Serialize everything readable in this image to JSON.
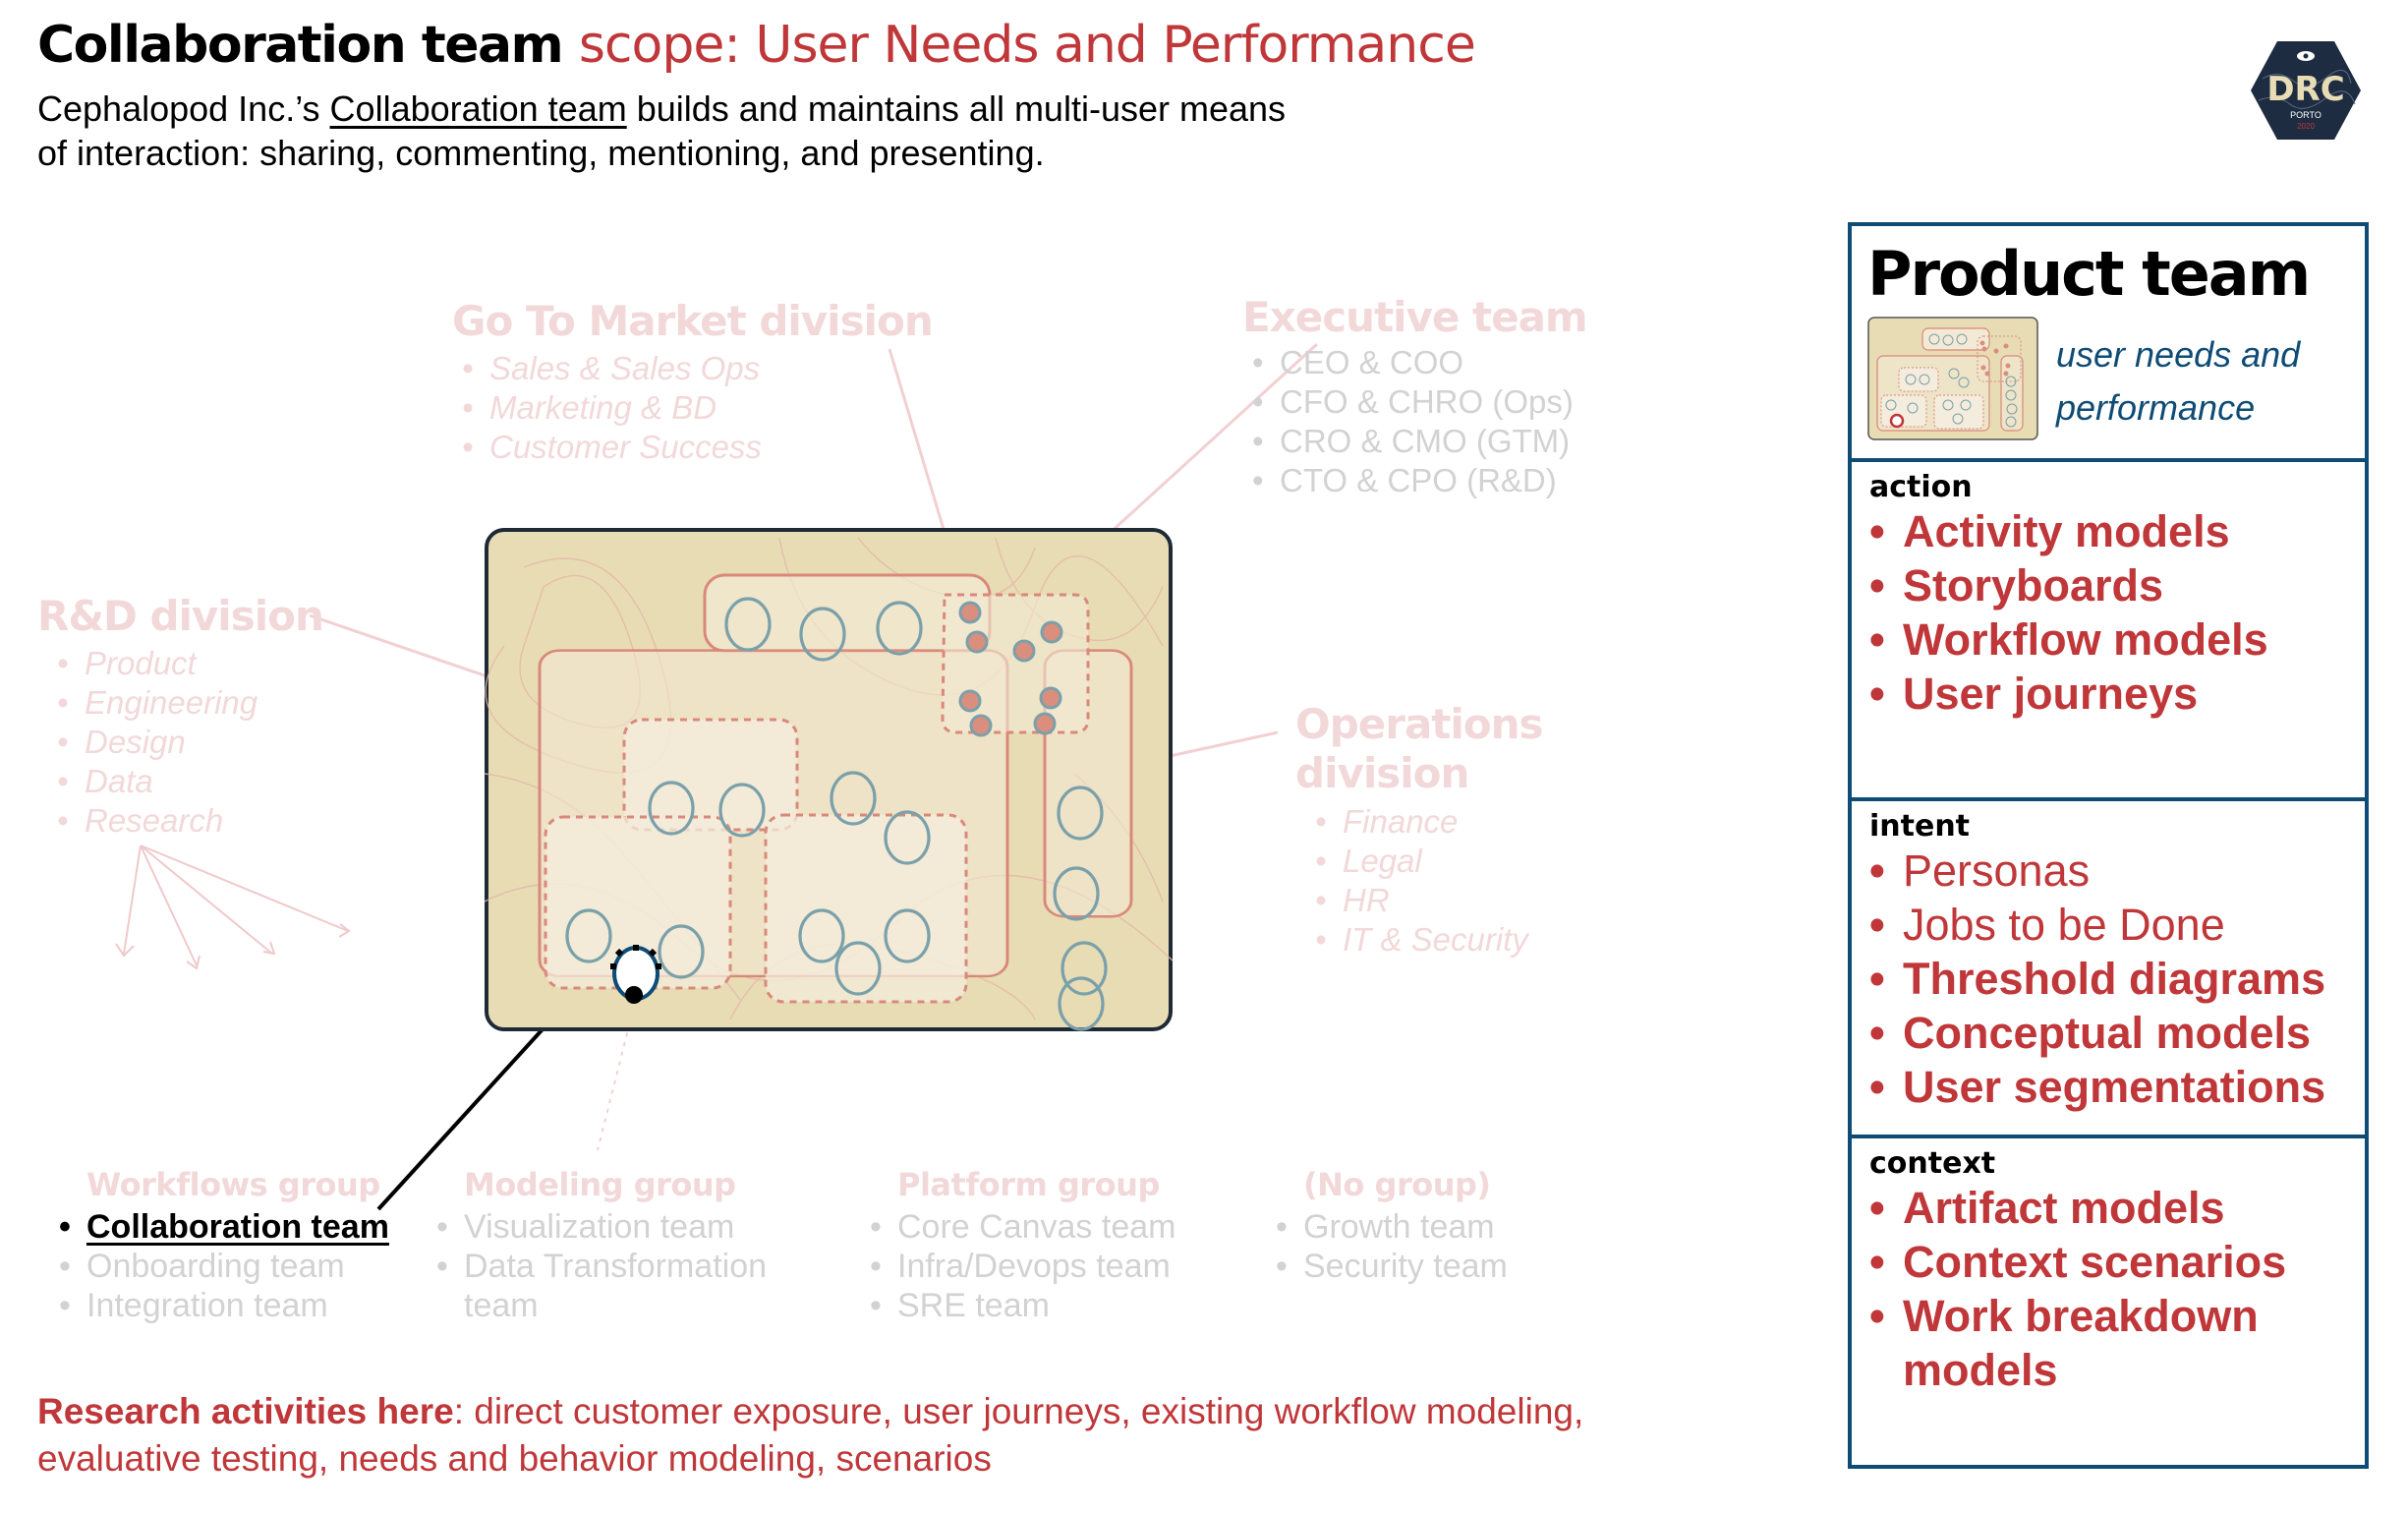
{
  "header": {
    "title_main": "Collaboration team",
    "title_accent": "scope: User Needs and Performance",
    "subtitle_before": "Cephalopod Inc.’s ",
    "subtitle_link": "Collaboration team",
    "subtitle_after": " builds and maintains all multi-user means of interaction: sharing, commenting, mentioning, and presenting."
  },
  "logo": {
    "text": "DRC",
    "city": "PORTO",
    "year": "2020",
    "icon": "eye-icon"
  },
  "colors": {
    "accent_red": "#c0373a",
    "panel_border": "#0f4c75",
    "faint_pink": "#f2d8d9",
    "map_bg": "#e8dcb5",
    "map_border": "#1f2a36",
    "node_ring": "#7aa0aa"
  },
  "divisions": {
    "gtm": {
      "title": "Go To Market division",
      "items": [
        "Sales & Sales Ops",
        "Marketing & BD",
        "Customer Success"
      ]
    },
    "exec": {
      "title": "Executive team",
      "items": [
        "CEO & COO",
        "CFO & CHRO (Ops)",
        "CRO & CMO (GTM)",
        "CTO & CPO (R&D)"
      ]
    },
    "rnd": {
      "title": "R&D division",
      "items": [
        "Product",
        "Engineering",
        "Design",
        "Data",
        "Research"
      ]
    },
    "ops": {
      "title_line1": "Operations",
      "title_line2": "division",
      "items": [
        "Finance",
        "Legal",
        "HR",
        "IT & Security"
      ]
    }
  },
  "groups": [
    {
      "title": "Workflows group",
      "items": [
        "Collaboration team",
        "Onboarding team",
        "Integration team"
      ],
      "highlight_index": 0
    },
    {
      "title": "Modeling group",
      "items": [
        "Visualization team",
        "Data Transformation team"
      ]
    },
    {
      "title": "Platform group",
      "items": [
        "Core Canvas team",
        "Infra/Devops team",
        "SRE team"
      ]
    },
    {
      "title": "(No group)",
      "items": [
        "Growth team",
        "Security team"
      ]
    }
  ],
  "panel": {
    "title": "Product team",
    "caption_line1": "user needs and",
    "caption_line2": "performance",
    "sections": [
      {
        "label": "action",
        "items": [
          {
            "text": "Activity models",
            "bold": true
          },
          {
            "text": "Storyboards",
            "bold": true
          },
          {
            "text": "Workflow models",
            "bold": true
          },
          {
            "text": "User journeys",
            "bold": true
          }
        ]
      },
      {
        "label": "intent",
        "items": [
          {
            "text": "Personas",
            "bold": false
          },
          {
            "text": "Jobs to be Done",
            "bold": false
          },
          {
            "text": "Threshold diagrams",
            "bold": true
          },
          {
            "text": "Conceptual models",
            "bold": true
          },
          {
            "text": "User segmentations",
            "bold": true
          }
        ]
      },
      {
        "label": "context",
        "items": [
          {
            "text": "Artifact models",
            "bold": true
          },
          {
            "text": "Context scenarios",
            "bold": true
          },
          {
            "text": "Work breakdown models",
            "bold": true
          }
        ]
      }
    ]
  },
  "research": {
    "label": "Research activities here",
    "text": ": direct customer exposure, user journeys, existing workflow modeling, evaluative testing, needs and behavior modeling, scenarios"
  }
}
